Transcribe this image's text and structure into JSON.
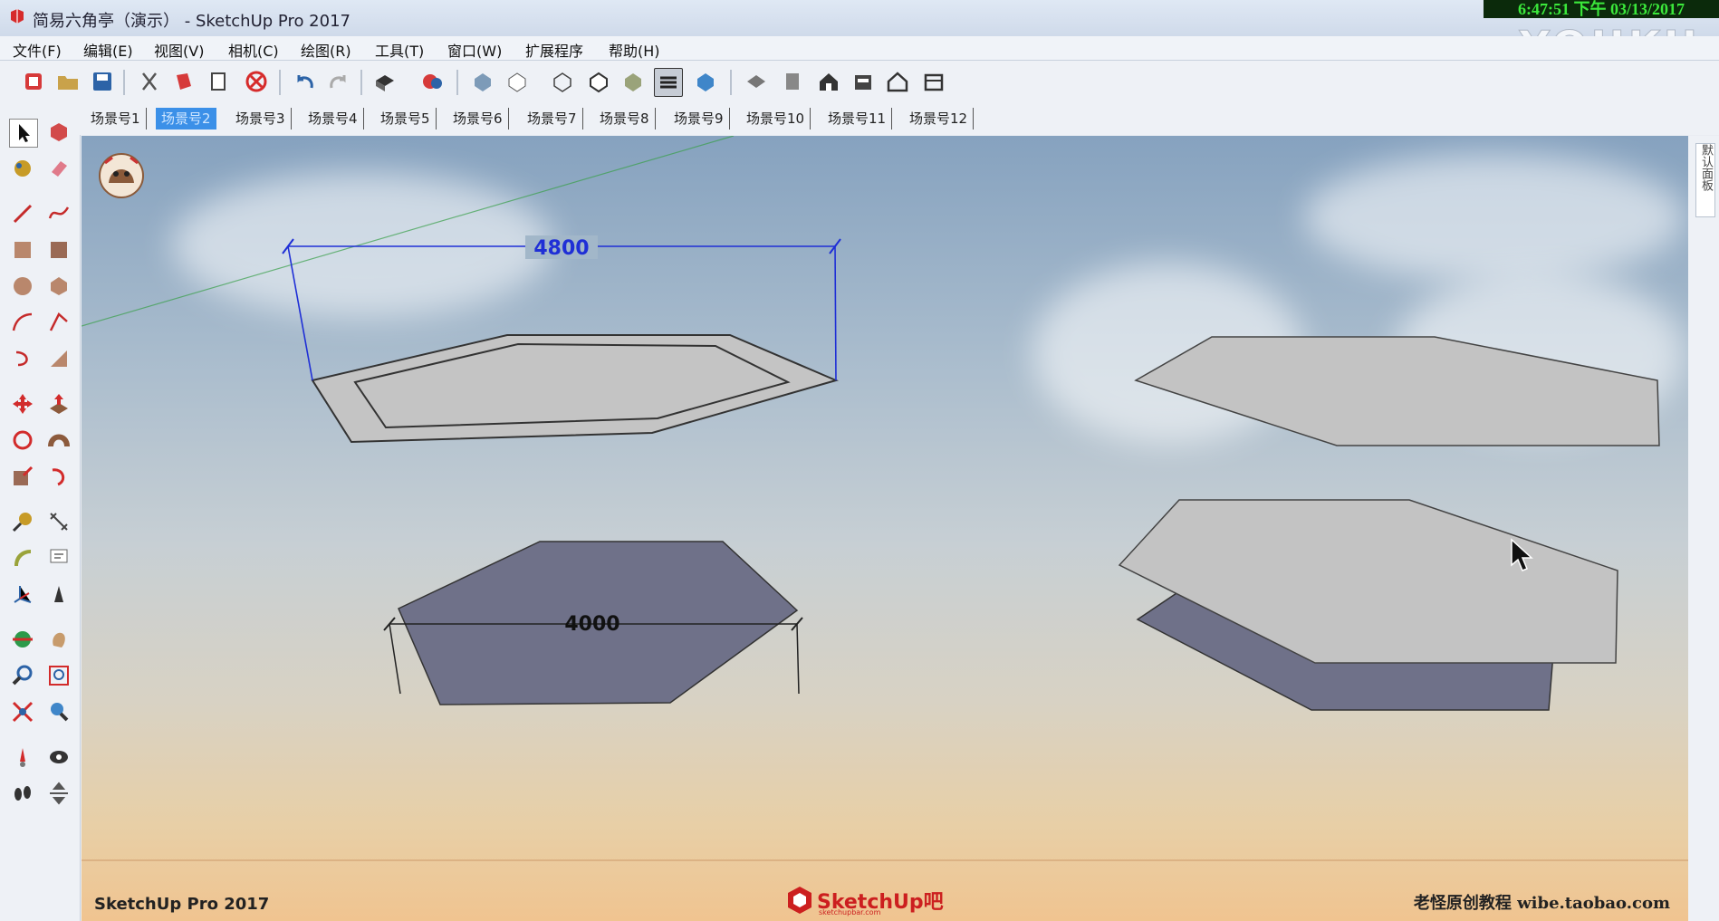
{
  "window": {
    "title": "简易六角亭（演示） - SketchUp Pro 2017",
    "clock": "6:47:51 下午 03/13/2017",
    "watermark": "YOUKU"
  },
  "menu": [
    "文件(F)",
    "编辑(E)",
    "视图(V)",
    "相机(C)",
    "绘图(R)",
    "工具(T)",
    "窗口(W)",
    "扩展程序",
    "帮助(H)"
  ],
  "scenes": {
    "tabs": [
      "场景号1",
      "场景号2",
      "场景号3",
      "场景号4",
      "场景号5",
      "场景号6",
      "场景号7",
      "场景号8",
      "场景号9",
      "场景号10",
      "场景号11",
      "场景号12"
    ],
    "active_index": 1
  },
  "viewport": {
    "dim_top": "4800",
    "dim_bottom": "4000",
    "footer_left": "SketchUp Pro 2017",
    "footer_brand": "SketchUp吧",
    "footer_brand_sub": "sketchupbar.com",
    "footer_right": "老怪原创教程  wibe.taobao.com"
  },
  "tray": {
    "label": "默认面板"
  },
  "colors": {
    "accent": "#3b90e8",
    "face_light": "#c3c3c3",
    "face_dark": "#6f7189",
    "dimension_blue": "#1f2fd6"
  }
}
